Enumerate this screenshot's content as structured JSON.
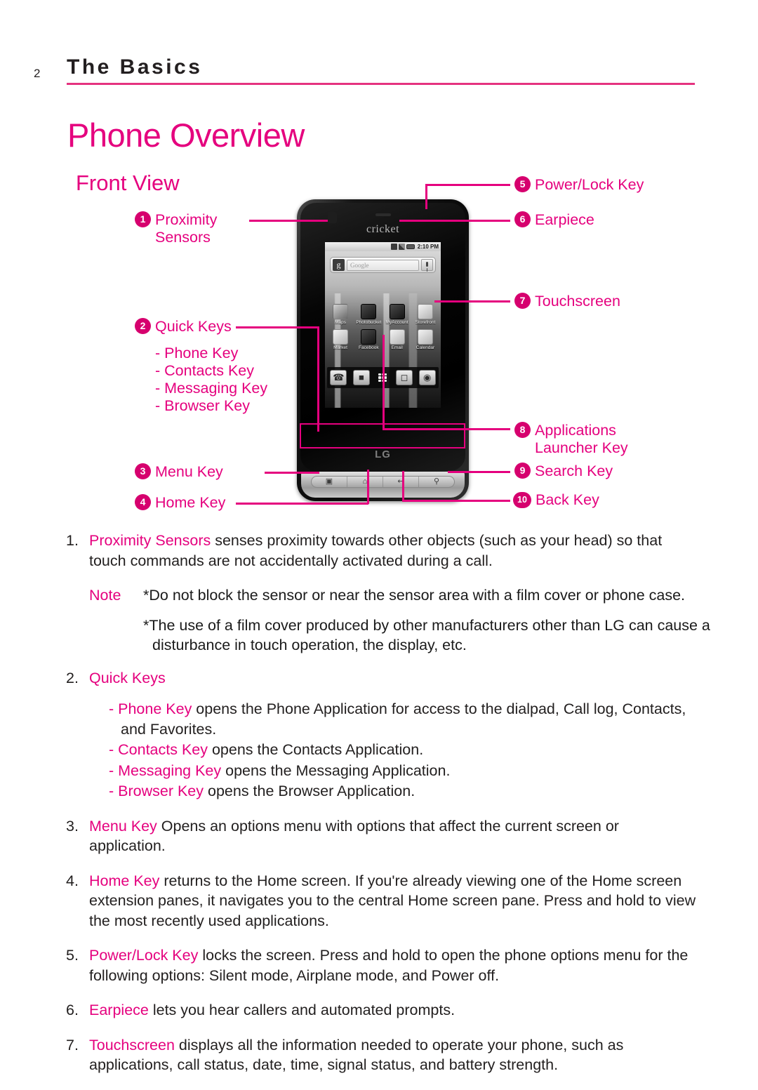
{
  "header": {
    "page_number": "2",
    "title": "The Basics",
    "rule_color": "#e5337f"
  },
  "doc_title": "Phone Overview",
  "section_title": "Front View",
  "accent_color": "#e5007e",
  "badge_color": "#d6006e",
  "callouts": [
    {
      "number": "1",
      "label": "Proximity",
      "label2": "Sensors"
    },
    {
      "number": "2",
      "label": "Quick Keys",
      "sub": [
        "- Phone Key",
        "- Contacts Key",
        "- Messaging Key",
        "- Browser Key"
      ]
    },
    {
      "number": "3",
      "label": "Menu Key"
    },
    {
      "number": "4",
      "label": "Home Key"
    },
    {
      "number": "5",
      "label": "Power/Lock Key"
    },
    {
      "number": "6",
      "label": "Earpiece"
    },
    {
      "number": "7",
      "label": "Touchscreen"
    },
    {
      "number": "8",
      "label": "Applications",
      "label2": "Launcher Key"
    },
    {
      "number": "9",
      "label": "Search Key"
    },
    {
      "number": "10",
      "label": "Back Key"
    }
  ],
  "phone": {
    "brand_top": "cricket",
    "brand_bottom": "LG",
    "status_bar": {
      "time": "2:10 PM"
    },
    "search_widget": {
      "logo": "g",
      "placeholder": "Google",
      "mic_icon": "microphone-icon"
    },
    "apps_row1": [
      "Maps",
      "Photobucket",
      "MyAccount",
      "Storefront"
    ],
    "apps_row2": [
      "Market",
      "Facebook",
      "Email",
      "Calendar"
    ],
    "dock_keys": [
      "phone-key",
      "contacts-key",
      "applications-launcher-key",
      "messaging-key",
      "browser-key"
    ],
    "hardware_keys": [
      "menu-key",
      "home-key",
      "back-key",
      "search-key"
    ],
    "hardware_glyphs": [
      "▣",
      "⌂",
      "↩",
      "⌕"
    ]
  },
  "body_items": [
    {
      "num": "1.",
      "parts": [
        {
          "text": "Proximity Sensors",
          "pink": true
        },
        {
          "text": " senses proximity towards other objects (such as your head) so that touch commands are not accidentally activated during a call.",
          "pink": false
        }
      ]
    },
    {
      "num": "2.",
      "parts": [
        {
          "text": "Quick Keys",
          "pink": true
        }
      ],
      "sublist": [
        [
          {
            "text": "- Phone Key",
            "pink": true
          },
          {
            "text": " opens the Phone Application for access to the dialpad, Call log, Contacts, and Favorites.",
            "pink": false
          }
        ],
        [
          {
            "text": "- Contacts Key",
            "pink": true
          },
          {
            "text": " opens the Contacts Application.",
            "pink": false
          }
        ],
        [
          {
            "text": "- Messaging Key",
            "pink": true
          },
          {
            "text": " opens the Messaging Application.",
            "pink": false
          }
        ],
        [
          {
            "text": "- Browser Key",
            "pink": true
          },
          {
            "text": " opens the Browser Application.",
            "pink": false
          }
        ]
      ]
    },
    {
      "num": "3.",
      "parts": [
        {
          "text": "Menu Key",
          "pink": true
        },
        {
          "text": " Opens an options menu with options that affect the current screen or application.",
          "pink": false
        }
      ]
    },
    {
      "num": "4.",
      "parts": [
        {
          "text": "Home Key",
          "pink": true
        },
        {
          "text": " returns to the Home screen. If you're already viewing one of the Home screen extension panes, it navigates you to the central Home screen pane. Press and hold to view the most recently used applications.",
          "pink": false
        }
      ]
    },
    {
      "num": "5.",
      "parts": [
        {
          "text": "Power/Lock Key",
          "pink": true
        },
        {
          "text": " locks the screen. Press and hold to open the phone options menu for the following options: Silent mode, Airplane mode, and Power off.",
          "pink": false
        }
      ]
    },
    {
      "num": "6.",
      "parts": [
        {
          "text": "Earpiece",
          "pink": true
        },
        {
          "text": " lets you hear callers and automated prompts.",
          "pink": false
        }
      ]
    },
    {
      "num": "7.",
      "parts": [
        {
          "text": "Touchscreen",
          "pink": true
        },
        {
          "text": " displays all the information needed to operate your phone, such as applications, call status, date, time, signal status, and battery strength.",
          "pink": false
        }
      ]
    }
  ],
  "note": {
    "word": "Note",
    "line1": "*Do not block the sensor or near the sensor area with a film cover or phone case.",
    "line2": "*The use of a film cover produced by other manufacturers other than LG can cause a disturbance in touch operation, the display, etc."
  }
}
